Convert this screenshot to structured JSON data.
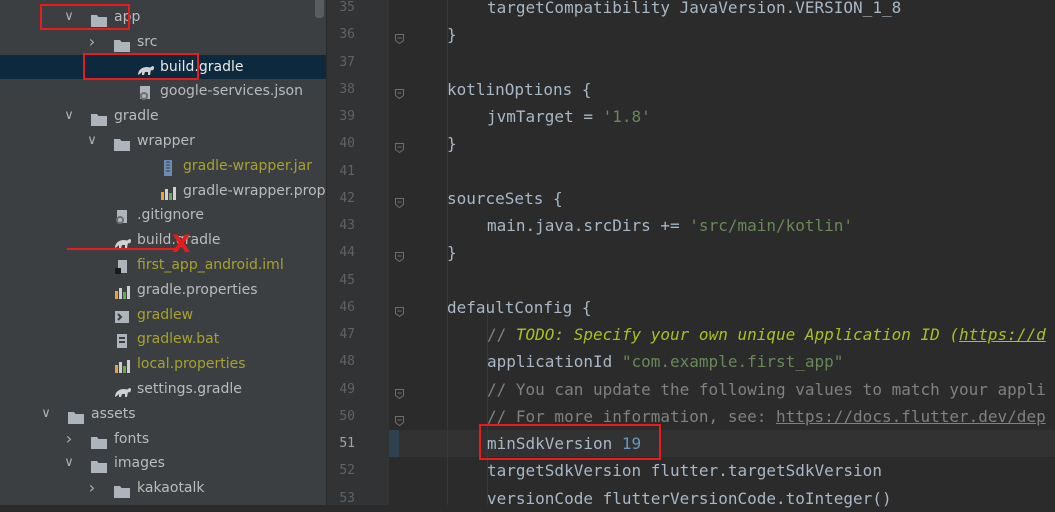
{
  "project_tree": [
    {
      "label": "app",
      "kind": "folder",
      "depth": 1,
      "arrow": "down",
      "boxed": true
    },
    {
      "label": "src",
      "kind": "folder",
      "depth": 2,
      "arrow": "right"
    },
    {
      "label": "build.gradle",
      "kind": "gradle",
      "depth": 3,
      "selected": true,
      "boxed": true
    },
    {
      "label": "google-services.json",
      "kind": "json",
      "depth": 3
    },
    {
      "label": "gradle",
      "kind": "folder",
      "depth": 1,
      "arrow": "down"
    },
    {
      "label": "wrapper",
      "kind": "folder",
      "depth": 2,
      "arrow": "down"
    },
    {
      "label": "gradle-wrapper.jar",
      "kind": "jar",
      "depth": 4,
      "color": "gold"
    },
    {
      "label": "gradle-wrapper.properties",
      "kind": "props",
      "depth": 4
    },
    {
      "label": ".gitignore",
      "kind": "gitignore",
      "depth": 2
    },
    {
      "label": "build.gradle",
      "kind": "gradle",
      "depth": 2,
      "struck": true
    },
    {
      "label": "first_app_android.iml",
      "kind": "iml",
      "depth": 2,
      "color": "gold"
    },
    {
      "label": "gradle.properties",
      "kind": "props",
      "depth": 2
    },
    {
      "label": "gradlew",
      "kind": "script",
      "depth": 2,
      "color": "gold"
    },
    {
      "label": "gradlew.bat",
      "kind": "bat",
      "depth": 2,
      "color": "gold"
    },
    {
      "label": "local.properties",
      "kind": "props",
      "depth": 2,
      "color": "gold"
    },
    {
      "label": "settings.gradle",
      "kind": "gradle",
      "depth": 2
    },
    {
      "label": "assets",
      "kind": "folder",
      "depth": 0,
      "arrow": "down"
    },
    {
      "label": "fonts",
      "kind": "folder",
      "depth": 1,
      "arrow": "right"
    },
    {
      "label": "images",
      "kind": "folder",
      "depth": 1,
      "arrow": "down"
    },
    {
      "label": "kakaotalk",
      "kind": "folder",
      "depth": 2,
      "arrow": "right"
    }
  ],
  "strike_mark": "X",
  "editor": {
    "current_line": 51,
    "lines": [
      {
        "n": "35",
        "indent": 8,
        "tokens": [
          {
            "t": "targetCompatibility JavaVersion.VERSION_1_8",
            "c": "plain"
          }
        ]
      },
      {
        "n": "36",
        "indent": 4,
        "tokens": [
          {
            "t": "}",
            "c": "plain"
          }
        ],
        "fold": true
      },
      {
        "n": "37",
        "indent": 0,
        "tokens": []
      },
      {
        "n": "38",
        "indent": 4,
        "tokens": [
          {
            "t": "kotlinOptions {",
            "c": "plain"
          }
        ],
        "fold": true
      },
      {
        "n": "39",
        "indent": 8,
        "tokens": [
          {
            "t": "jvmTarget = ",
            "c": "plain"
          },
          {
            "t": "'1.8'",
            "c": "str"
          }
        ]
      },
      {
        "n": "40",
        "indent": 4,
        "tokens": [
          {
            "t": "}",
            "c": "plain"
          }
        ],
        "fold": true
      },
      {
        "n": "41",
        "indent": 0,
        "tokens": []
      },
      {
        "n": "42",
        "indent": 4,
        "tokens": [
          {
            "t": "sourceSets {",
            "c": "plain"
          }
        ],
        "fold": true
      },
      {
        "n": "43",
        "indent": 8,
        "tokens": [
          {
            "t": "main.java.srcDirs += ",
            "c": "plain"
          },
          {
            "t": "'src/main/kotlin'",
            "c": "str"
          }
        ]
      },
      {
        "n": "44",
        "indent": 4,
        "tokens": [
          {
            "t": "}",
            "c": "plain"
          }
        ],
        "fold": true
      },
      {
        "n": "45",
        "indent": 0,
        "tokens": []
      },
      {
        "n": "46",
        "indent": 4,
        "tokens": [
          {
            "t": "defaultConfig {",
            "c": "plain"
          }
        ],
        "fold": true
      },
      {
        "n": "47",
        "indent": 8,
        "tokens": [
          {
            "t": "// ",
            "c": "com"
          },
          {
            "t": "TODO: Specify your own unique Application ID (",
            "c": "todo"
          },
          {
            "t": "https://d",
            "c": "todolink"
          }
        ]
      },
      {
        "n": "48",
        "indent": 8,
        "tokens": [
          {
            "t": "applicationId ",
            "c": "plain"
          },
          {
            "t": "\"com.example.first_app\"",
            "c": "str"
          }
        ]
      },
      {
        "n": "49",
        "indent": 8,
        "tokens": [
          {
            "t": "// You can update the following values to match your appli",
            "c": "com"
          }
        ],
        "fold": true
      },
      {
        "n": "50",
        "indent": 8,
        "tokens": [
          {
            "t": "// For more information, see: ",
            "c": "com"
          },
          {
            "t": "https://docs.flutter.dev/dep",
            "c": "link"
          }
        ],
        "fold": true
      },
      {
        "n": "51",
        "indent": 8,
        "tokens": [
          {
            "t": "minSdkVersion ",
            "c": "plain"
          },
          {
            "t": "19",
            "c": "num"
          }
        ]
      },
      {
        "n": "52",
        "indent": 8,
        "tokens": [
          {
            "t": "targetSdkVersion flutter.targetSdkVersion",
            "c": "plain"
          }
        ]
      },
      {
        "n": "53",
        "indent": 8,
        "tokens": [
          {
            "t": "versionCode flutterVersionCode.toInteger()",
            "c": "plain"
          }
        ]
      }
    ]
  }
}
